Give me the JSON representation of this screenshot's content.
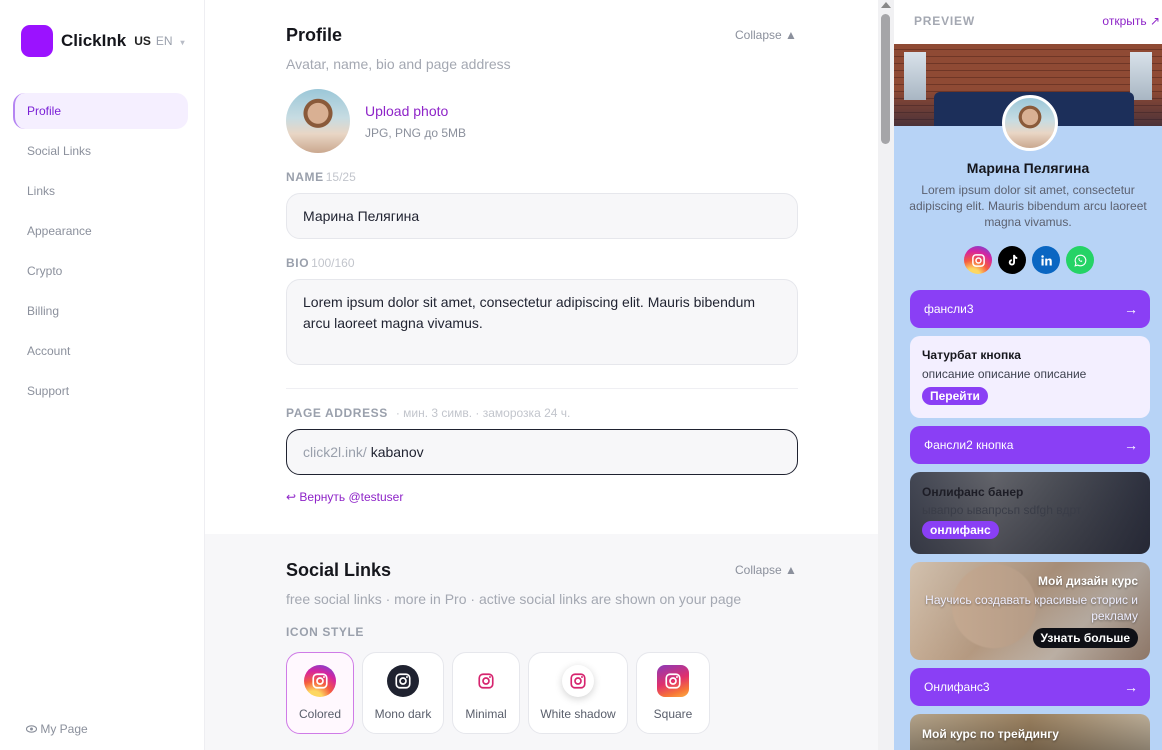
{
  "brand": {
    "name": "ClickInk",
    "lang_primary": "US",
    "lang_secondary": "EN",
    "caret": "▾"
  },
  "nav": {
    "items": [
      {
        "label": "Profile"
      },
      {
        "label": "Social Links"
      },
      {
        "label": "Links"
      },
      {
        "label": "Appearance"
      },
      {
        "label": "Crypto"
      },
      {
        "label": "Billing"
      },
      {
        "label": "Account"
      },
      {
        "label": "Support"
      }
    ],
    "my_page": "My Page"
  },
  "profile": {
    "title": "Profile",
    "collapse": "Collapse ▲",
    "subtitle": "Avatar, name, bio and page address",
    "upload_label": "Upload photo",
    "upload_hint": "JPG, PNG до 5MB",
    "name_label": "NAME",
    "name_count": "15/25",
    "name_value": "Марина Пелягина",
    "bio_label": "BIO",
    "bio_count": "100/160",
    "bio_value": "Lorem ipsum dolor sit amet, consectetur adipiscing elit. Mauris bibendum arcu laoreet magna vivamus.",
    "address_label": "PAGE ADDRESS",
    "address_hint": "· мин. 3 симв. · заморозка 24 ч.",
    "address_prefix": "click2l.ink/",
    "address_value": "kabanov",
    "revert": "↩ Вернуть @testuser"
  },
  "social": {
    "title": "Social Links",
    "collapse": "Collapse ▲",
    "subtitle": "free social links · more in Pro · active social links are shown on your page",
    "icon_style_label": "ICON STYLE",
    "styles": [
      {
        "label": "Colored"
      },
      {
        "label": "Mono dark"
      },
      {
        "label": "Minimal"
      },
      {
        "label": "White shadow"
      },
      {
        "label": "Square"
      }
    ]
  },
  "preview": {
    "label": "PREVIEW",
    "open": "открыть ↗",
    "name": "Марина Пелягина",
    "bio": "Lorem ipsum dolor sit amet, consectetur adipiscing elit. Mauris bibendum arcu laoreet magna vivamus.",
    "socials": [
      "instagram-icon",
      "tiktok-icon",
      "linkedin-icon",
      "whatsapp-icon"
    ],
    "link1": "фансли3",
    "card_title": "Чатурбат кнопка",
    "card_desc": "описание описание описание",
    "card_button": "Перейти",
    "link2": "Фансли2 кнопка",
    "banner_title": "Онлифанс банер",
    "banner_desc": "ывапро ывапрсьп sdfgh вдрт",
    "banner_button": "онлифанс",
    "course_title": "Мой дизайн курс",
    "course_desc": "Научись создавать красивые сторис и рекламу",
    "course_button": "Узнать больше",
    "link3": "Онлифанс3",
    "trade_title": "Мой курс по трейдингу",
    "arrow": "→"
  },
  "colors": {
    "accent": "#8a3ff5",
    "brand": "#9b12ff",
    "preview_bg": "#b7d3f6"
  }
}
